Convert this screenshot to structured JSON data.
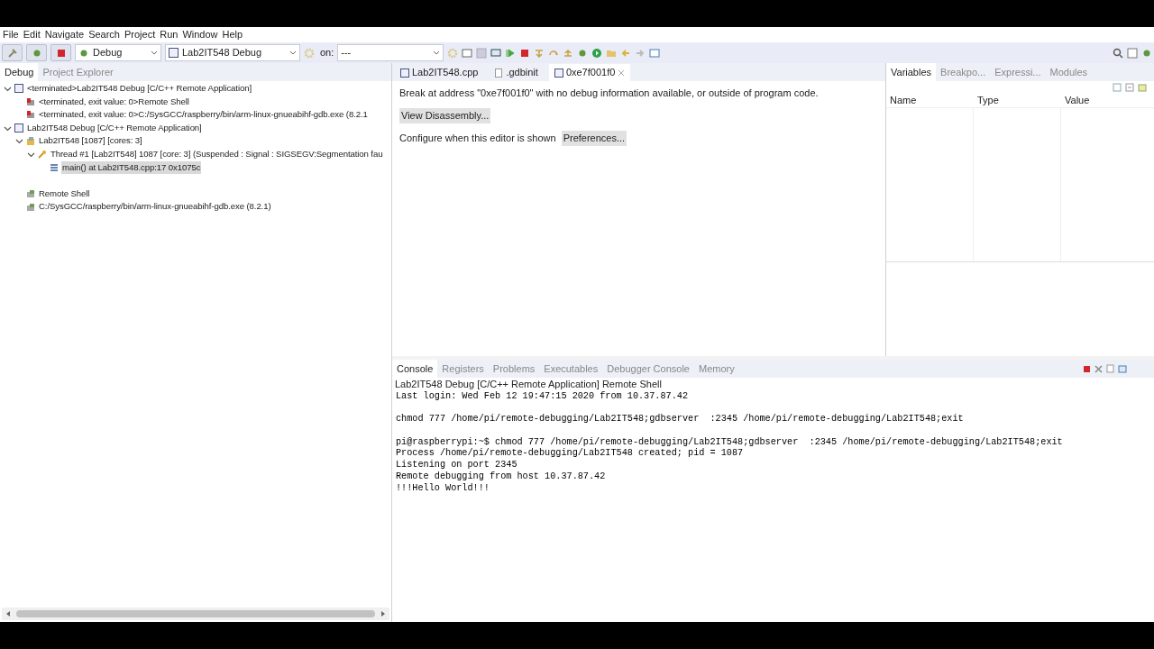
{
  "menu": [
    "File",
    "Edit",
    "Navigate",
    "Search",
    "Project",
    "Run",
    "Window",
    "Help"
  ],
  "toolbar": {
    "perspective": "Debug",
    "launch_config": "Lab2IT548 Debug",
    "target_label": "on:",
    "target": "---"
  },
  "debug_view": {
    "tabs": [
      {
        "label": "Debug",
        "selected": true
      },
      {
        "label": "Project Explorer",
        "selected": false
      }
    ],
    "tree": [
      {
        "kind": "launch",
        "label": "<terminated>Lab2IT548 Debug [C/C++ Remote Application]",
        "expanded": true,
        "selected": false,
        "children": [
          {
            "kind": "terminated",
            "label": "<terminated, exit value: 0>Remote Shell",
            "selected": false
          },
          {
            "kind": "terminated",
            "label": "<terminated, exit value: 0>C:/SysGCC/raspberry/bin/arm-linux-gnueabihf-gdb.exe (8.2.1",
            "selected": false
          }
        ]
      },
      {
        "kind": "launch",
        "label": "Lab2IT548 Debug [C/C++ Remote Application]",
        "expanded": true,
        "selected": false,
        "children": [
          {
            "kind": "target",
            "label": "Lab2IT548 [1087] [cores: 3]",
            "expanded": true,
            "selected": false,
            "children": [
              {
                "kind": "thread",
                "label": "Thread #1 [Lab2IT548] 1087 [core: 3] (Suspended : Signal : SIGSEGV:Segmentation fau",
                "expanded": true,
                "selected": false,
                "children": [
                  {
                    "kind": "frame",
                    "label": "main() at Lab2IT548.cpp:17 0x1075c",
                    "selected": true
                  }
                ]
              }
            ]
          },
          {
            "kind": "process",
            "label": "Remote Shell",
            "selected": false
          },
          {
            "kind": "process",
            "label": "C:/SysGCC/raspberry/bin/arm-linux-gnueabihf-gdb.exe (8.2.1)",
            "selected": false
          }
        ]
      }
    ]
  },
  "editor": {
    "tabs": [
      {
        "label": "Lab2IT548.cpp",
        "kind": "c",
        "selected": false
      },
      {
        "label": ".gdbinit",
        "kind": "file",
        "selected": false
      },
      {
        "label": "0xe7f001f0",
        "kind": "c",
        "selected": true
      }
    ],
    "message": "Break at address \"0xe7f001f0\" with no debug information available, or outside of program code.",
    "view_button": "View Disassembly...",
    "configure_text": "Configure when this editor is shown",
    "preferences_button": "Preferences..."
  },
  "variables_view": {
    "tabs": [
      {
        "label": "Variables",
        "selected": true
      },
      {
        "label": "Breakpo...",
        "selected": false
      },
      {
        "label": "Expressi...",
        "selected": false
      },
      {
        "label": "Modules",
        "selected": false
      }
    ],
    "columns": [
      "Name",
      "Type",
      "Value"
    ]
  },
  "console_view": {
    "tabs": [
      {
        "label": "Console",
        "selected": true
      },
      {
        "label": "Registers",
        "selected": false
      },
      {
        "label": "Problems",
        "selected": false
      },
      {
        "label": "Executables",
        "selected": false
      },
      {
        "label": "Debugger Console",
        "selected": false
      },
      {
        "label": "Memory",
        "selected": false
      }
    ],
    "title": "Lab2IT548 Debug [C/C++ Remote Application] Remote Shell",
    "blocks": [
      [
        "Last login: Wed Feb 12 19:47:15 2020 from 10.37.87.42"
      ],
      [
        "chmod 777 /home/pi/remote-debugging/Lab2IT548;gdbserver  :2345 /home/pi/remote-debugging/Lab2IT548;exit"
      ],
      [
        "pi@raspberrypi:~$ chmod 777 /home/pi/remote-debugging/Lab2IT548;gdbserver  :2345 /home/pi/remote-debugging/Lab2IT548;exit",
        "Process /home/pi/remote-debugging/Lab2IT548 created; pid = 1087",
        "Listening on port 2345",
        "Remote debugging from host 10.37.87.42",
        "!!!Hello World!!!"
      ]
    ]
  }
}
